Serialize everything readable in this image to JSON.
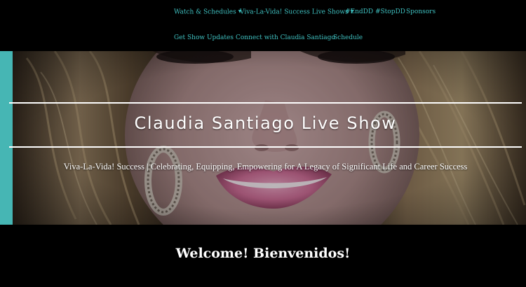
{
  "nav": {
    "row1": [
      {
        "label": "Watch & Schedules",
        "has_dropdown": true
      },
      {
        "label": "Viva-La-Vida! Success Live Shows",
        "has_dropdown": true
      },
      {
        "label": "#EndDD #StopDD",
        "has_dropdown": false
      },
      {
        "label": "Sponsors",
        "has_dropdown": false
      }
    ],
    "row2": [
      {
        "label": "Get Show Updates",
        "has_dropdown": false
      },
      {
        "label": "Connect with Claudia Santiago",
        "has_dropdown": false
      },
      {
        "label": "Schedule",
        "has_dropdown": false
      }
    ],
    "dropdown_icon": "chevron-down-icon",
    "link_color": "#3fc0c0"
  },
  "hero": {
    "title": "Claudia Santiago Live Show",
    "tagline": "Viva-La-Vida! Success | Celebrating, Equipping, Empowering for A Legacy of Significant Life and Career Success",
    "accent_color": "#46b6b4"
  },
  "welcome": {
    "heading": "Welcome! Bienvenidos!"
  }
}
